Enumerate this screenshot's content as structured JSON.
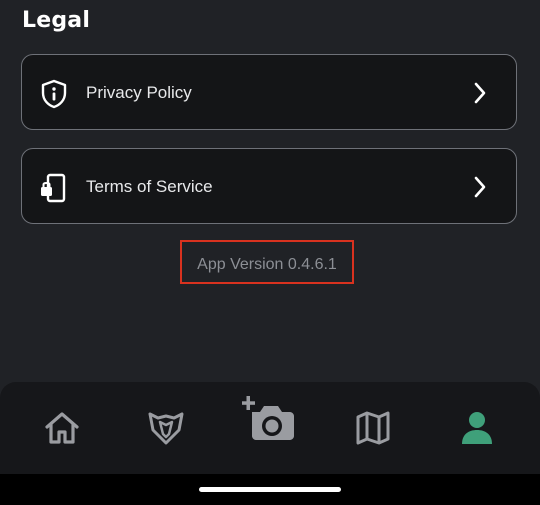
{
  "legal": {
    "title": "Legal",
    "items": [
      {
        "label": "Privacy Policy",
        "icon": "shield-info-icon"
      },
      {
        "label": "Terms of Service",
        "icon": "phone-lock-icon"
      }
    ]
  },
  "version": {
    "text": "App Version 0.4.6.1",
    "highlight_color": "#d8321f"
  },
  "bottom_nav": {
    "items": [
      {
        "name": "home",
        "icon": "home-icon",
        "active": false
      },
      {
        "name": "guild",
        "icon": "shield-wolf-icon",
        "active": false
      },
      {
        "name": "add-photo",
        "icon": "camera-plus-icon",
        "active": false
      },
      {
        "name": "map",
        "icon": "map-icon",
        "active": false
      },
      {
        "name": "profile",
        "icon": "person-icon",
        "active": true
      }
    ],
    "active_color": "#3fa07a",
    "inactive_color": "#9a9ca1"
  }
}
